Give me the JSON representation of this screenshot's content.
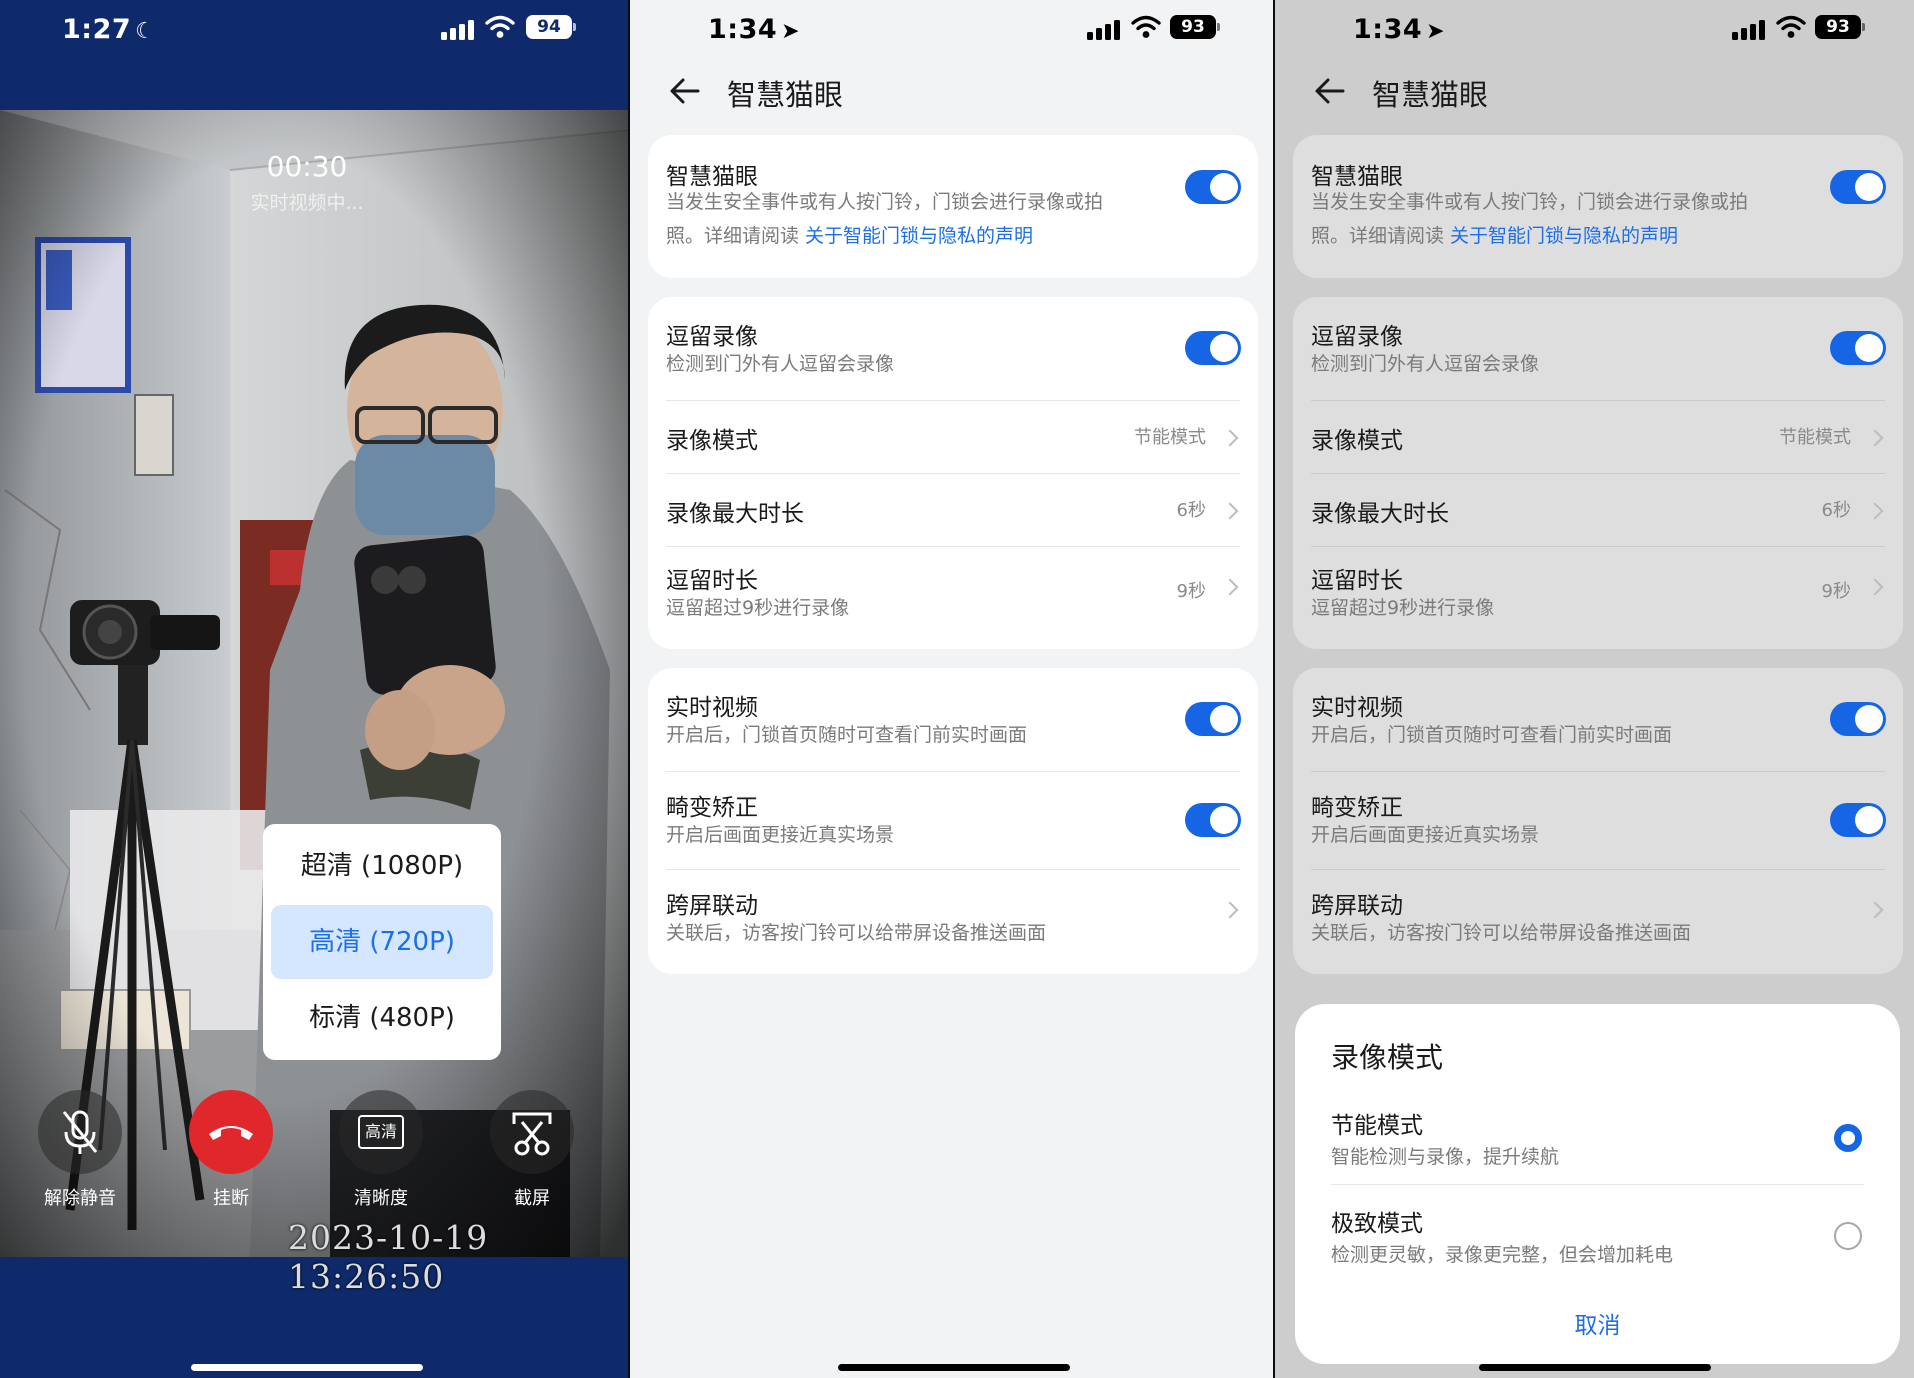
{
  "screen1": {
    "status": {
      "time": "1:27",
      "battery": "94"
    },
    "timer": "00:30",
    "live_status": "实时视频中...",
    "quality_options": [
      {
        "label": "超清 (1080P)",
        "selected": false
      },
      {
        "label": "高清 (720P)",
        "selected": true
      },
      {
        "label": "标清 (480P)",
        "selected": false
      }
    ],
    "controls": {
      "unmute": "解除静音",
      "hangup": "挂断",
      "quality": "清晰度",
      "quality_icon_text": "高清",
      "screenshot": "截屏"
    },
    "timestamp": "2023-10-19 13:26:50"
  },
  "settings": {
    "status": {
      "time": "1:34",
      "battery": "93"
    },
    "header_title": "智慧猫眼",
    "card1": {
      "title": "智慧猫眼",
      "desc_line1": "当发生安全事件或有人按门铃，门锁会进行录像或拍",
      "desc_line2_prefix": "照。详细请阅读 ",
      "desc_link": "关于智能门锁与隐私的声明",
      "enabled": true
    },
    "card2": {
      "linger_title": "逗留录像",
      "linger_desc": "检测到门外有人逗留会录像",
      "linger_enabled": true,
      "mode_title": "录像模式",
      "mode_value": "节能模式",
      "maxlen_title": "录像最大时长",
      "maxlen_value": "6秒",
      "duration_title": "逗留时长",
      "duration_desc": "逗留超过9秒进行录像",
      "duration_value": "9秒"
    },
    "card3": {
      "live_title": "实时视频",
      "live_desc": "开启后，门锁首页随时可查看门前实时画面",
      "live_enabled": true,
      "distort_title": "畸变矫正",
      "distort_desc": "开启后画面更接近真实场景",
      "distort_enabled": true,
      "cross_title": "跨屏联动",
      "cross_desc": "关联后，访客按门铃可以给带屏设备推送画面"
    }
  },
  "sheet": {
    "title": "录像模式",
    "options": [
      {
        "title": "节能模式",
        "desc": "智能检测与录像，提升续航",
        "selected": true
      },
      {
        "title": "极致模式",
        "desc": "检测更灵敏，录像更完整，但会增加耗电",
        "selected": false
      }
    ],
    "cancel": "取消"
  },
  "colors": {
    "accent": "#1565e5",
    "link": "#1c6fe7",
    "hangup": "#e0282c",
    "quality_selected_bg": "#d5e6ff"
  }
}
